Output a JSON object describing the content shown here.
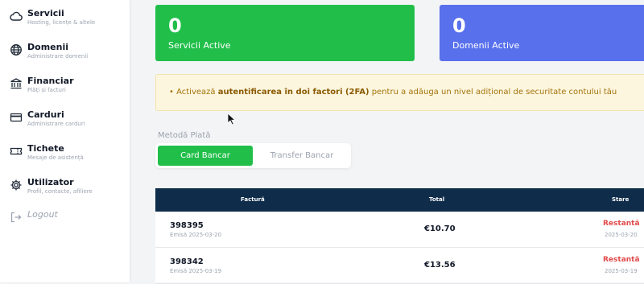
{
  "sidebar": {
    "items": [
      {
        "title": "Servicii",
        "subtitle": "Hosting, licențe & altele",
        "icon": "cloud-icon"
      },
      {
        "title": "Domenii",
        "subtitle": "Administrare domenii",
        "icon": "globe-icon"
      },
      {
        "title": "Financiar",
        "subtitle": "Plăți și facturi",
        "icon": "bank-icon"
      },
      {
        "title": "Carduri",
        "subtitle": "Administrare carduri",
        "icon": "credit-card-icon"
      },
      {
        "title": "Tichete",
        "subtitle": "Mesaje de asistență",
        "icon": "ticket-icon"
      },
      {
        "title": "Utilizator",
        "subtitle": "Profil, contacte, afiliere",
        "icon": "gear-icon"
      }
    ],
    "logout": {
      "title": "Logout",
      "icon": "logout-icon"
    }
  },
  "stats": {
    "services": {
      "value": "0",
      "label": "Servicii Active",
      "color": "#21bf4a"
    },
    "domains": {
      "value": "0",
      "label": "Domenii Active",
      "color": "#5870ec"
    }
  },
  "alert": {
    "bullet": "•",
    "prefix": "Activează",
    "bold": "autentificarea în doi factori (2FA)",
    "suffix": "pentru a adăuga un nivel adițional de securitate contului tău"
  },
  "payment": {
    "label": "Metodă Plată",
    "options": [
      "Card Bancar",
      "Transfer Bancar"
    ],
    "selected": "Card Bancar"
  },
  "table": {
    "headers": {
      "invoice": "Factură",
      "total": "Total",
      "status": "Stare"
    },
    "rows": [
      {
        "number": "398395",
        "issued": "Emisă 2025-03-20",
        "total": "€10.70",
        "status": "Restantă",
        "status_date": "2025-03-20"
      },
      {
        "number": "398342",
        "issued": "Emisă 2025-03-19",
        "total": "€13.56",
        "status": "Restantă",
        "status_date": "2025-03-19"
      }
    ]
  }
}
